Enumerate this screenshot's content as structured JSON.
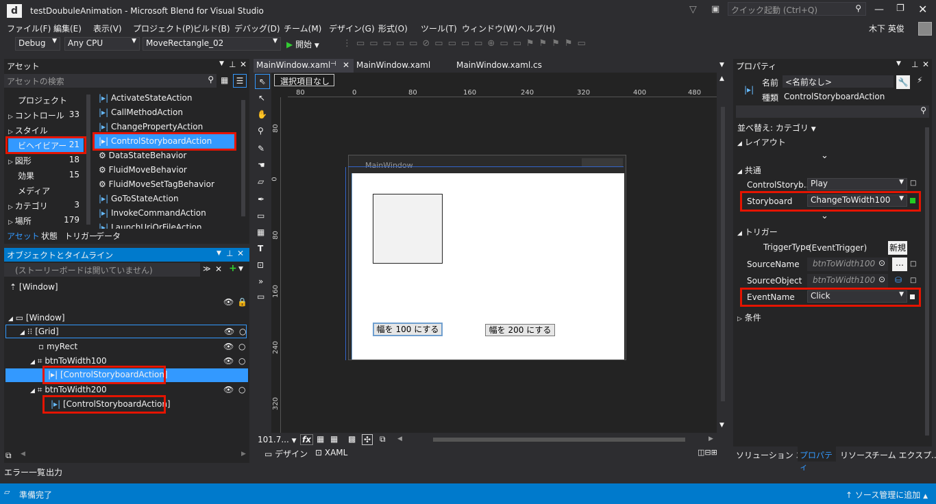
{
  "title": "testDoubuleAnimation - Microsoft Blend for Visual Studio",
  "quick_launch": "クイック起動 (Ctrl+Q)",
  "user": "木下 英俊",
  "menu": [
    "ファイル(F)",
    "編集(E)",
    "表示(V)",
    "プロジェクト(P)",
    "ビルド(B)",
    "デバッグ(D)",
    "チーム(M)",
    "デザイン(G)",
    "形式(O)",
    "ツール(T)",
    "ウィンドウ(W)",
    "ヘルプ(H)"
  ],
  "toolbar": {
    "config": "Debug",
    "platform": "Any CPU",
    "target": "MoveRectangle_02",
    "start": "開始"
  },
  "assets": {
    "header": "アセット",
    "search_placeholder": "アセットの検索",
    "categories": [
      {
        "label": "プロジェクト",
        "count": ""
      },
      {
        "label": "コントロール",
        "count": "33"
      },
      {
        "label": "スタイル",
        "count": ""
      },
      {
        "label": "ビヘイビアー",
        "count": "21"
      },
      {
        "label": "図形",
        "count": "18"
      },
      {
        "label": "効果",
        "count": "15"
      },
      {
        "label": "メディア",
        "count": ""
      },
      {
        "label": "カテゴリ",
        "count": "3"
      },
      {
        "label": "場所",
        "count": "179"
      }
    ],
    "items": [
      "ActivateStateAction",
      "CallMethodAction",
      "ChangePropertyAction",
      "ControlStoryboardAction",
      "DataStateBehavior",
      "FluidMoveBehavior",
      "FluidMoveSetTagBehavior",
      "GoToStateAction",
      "InvokeCommandAction",
      "LaunchUriOrFileAction"
    ],
    "tabs": [
      "アセット",
      "状態",
      "トリガー",
      "データ"
    ]
  },
  "objects": {
    "header": "オブジェクトとタイムライン",
    "storyboard_placeholder": "(ストーリーボードは開いていません)",
    "root": "[Window]",
    "tree": [
      {
        "label": "[Window]"
      },
      {
        "label": "[Grid]"
      },
      {
        "label": "myRect"
      },
      {
        "label": "btnToWidth100"
      },
      {
        "label": "[ControlStoryboardAction]"
      },
      {
        "label": "btnToWidth200"
      },
      {
        "label": "[ControlStoryboardAction]"
      }
    ]
  },
  "doc_tabs": [
    "MainWindow.xaml",
    "MainWindow.xaml",
    "MainWindow.xaml.cs"
  ],
  "designer": {
    "breadcrumb": "選択項目なし",
    "ruler_h": [
      "80",
      "0",
      "80",
      "160",
      "240",
      "320",
      "400",
      "480"
    ],
    "ruler_v": [
      "80",
      "0",
      "80",
      "160",
      "240",
      "320"
    ],
    "window_title": "MainWindow",
    "btn1": "幅を 100 にする",
    "btn2": "幅を 200 にする",
    "zoom": "101.7...",
    "view_tabs": [
      "デザイン",
      "XAML"
    ]
  },
  "properties": {
    "header": "プロパティ",
    "name_label": "名前",
    "name_value": "<名前なし>",
    "type_label": "種類",
    "type_value": "ControlStoryboardAction",
    "sort": "並べ替え: カテゴリ",
    "sections": {
      "layout": "レイアウト",
      "common": "共通",
      "trigger": "トリガー",
      "condition": "条件"
    },
    "rows": {
      "csa_label": "ControlStoryb...",
      "csa_value": "Play",
      "sb_label": "Storyboard",
      "sb_value": "ChangeToWidth100",
      "tt_label": "TriggerType",
      "tt_value": "(EventTrigger)",
      "new_btn": "新規",
      "sn_label": "SourceName",
      "sn_value": "btnToWidth100",
      "so_label": "SourceObject",
      "so_value": "btnToWidth100",
      "en_label": "EventName",
      "en_value": "Click"
    },
    "bottom_tabs": [
      "ソリューション エ...",
      "プロパティ",
      "リソース",
      "チーム エクスプ..."
    ]
  },
  "output_tabs": [
    "エラー一覧",
    "出力"
  ],
  "status": {
    "text": "準備完了",
    "right": "ソース管理に追加"
  }
}
